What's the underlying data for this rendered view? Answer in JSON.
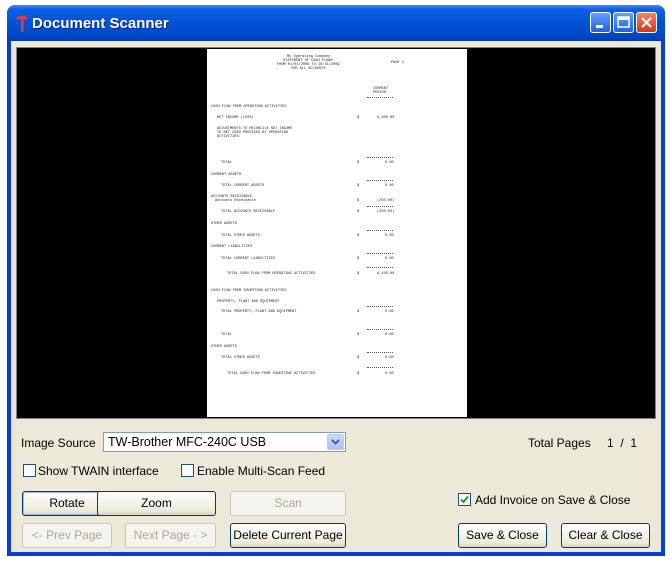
{
  "window": {
    "title": "Document Scanner"
  },
  "image_source": {
    "label": "Image Source",
    "value": "TW-Brother MFC-240C USB"
  },
  "total_pages": {
    "label": "Total Pages",
    "value": "1  /  1"
  },
  "options": {
    "show_twain": {
      "label": "Show TWAIN interface",
      "checked": false
    },
    "multi_scan": {
      "label": "Enable Multi-Scan Feed",
      "checked": false
    },
    "add_invoice": {
      "label": "Add Invoice on Save & Close",
      "checked": true
    }
  },
  "buttons": {
    "rotate": "Rotate",
    "zoom": "Zoom",
    "scan": "Scan",
    "prev_page": "<- Prev Page",
    "next_page": "Next Page - >",
    "delete_page": "Delete Current Page",
    "save_close": "Save & Close",
    "clear_close": "Clear & Close"
  },
  "document": {
    "company": "My Operating Company",
    "statement": "STATEMENT OF CASH FLOWS",
    "period": "FROM 01/01/2009 TO 10/31/2009",
    "accounts": "FOR ALL ACCOUNTS",
    "page": "PAGE 1",
    "col_head_1": "CURRENT",
    "col_head_2": "PERIOD",
    "lines": [
      "CASH FLOW FROM OPERATING ACTIVITIES",
      "NET INCOME (LOSS)",
      "ADJUSTMENTS TO RECONCILE NET INCOME",
      "TO NET CASH PROVIDED BY OPERATING",
      "ACTIVITIES:",
      "TOTAL",
      "CURRENT ASSETS",
      "TOTAL CURRENT ASSETS",
      "ACCOUNTS RECEIVABLE",
      "Accounts Receivable",
      "TOTAL ACCOUNTS RECEIVABLE",
      "OTHER ASSETS",
      "TOTAL OTHER ASSETS",
      "CURRENT LIABILITIES",
      "TOTAL CURRENT LIABILITIES",
      "TOTAL CASH FLOW FROM OPERATING ACTIVITIES",
      "CASH FLOW FROM INVESTING ACTIVITIES",
      "PROPERTY, PLANT AND EQUIPMENT",
      "TOTAL PROPERTY, PLANT AND EQUIPMENT",
      "TOTAL",
      "OTHER ASSETS",
      "TOTAL OTHER ASSETS",
      "TOTAL CASH FLOW FROM INVESTING ACTIVITIES"
    ],
    "amounts": [
      "$",
      "6,400.00",
      "$",
      "0.00",
      "$",
      "0.00",
      "$",
      "(250.00)",
      "$",
      "(250.00)",
      "$",
      "0.00",
      "$",
      "0.00",
      "$",
      "6,150.00",
      "$",
      "0.00",
      "$",
      "0.00",
      "$",
      "0.00",
      "$",
      "0.00"
    ]
  }
}
